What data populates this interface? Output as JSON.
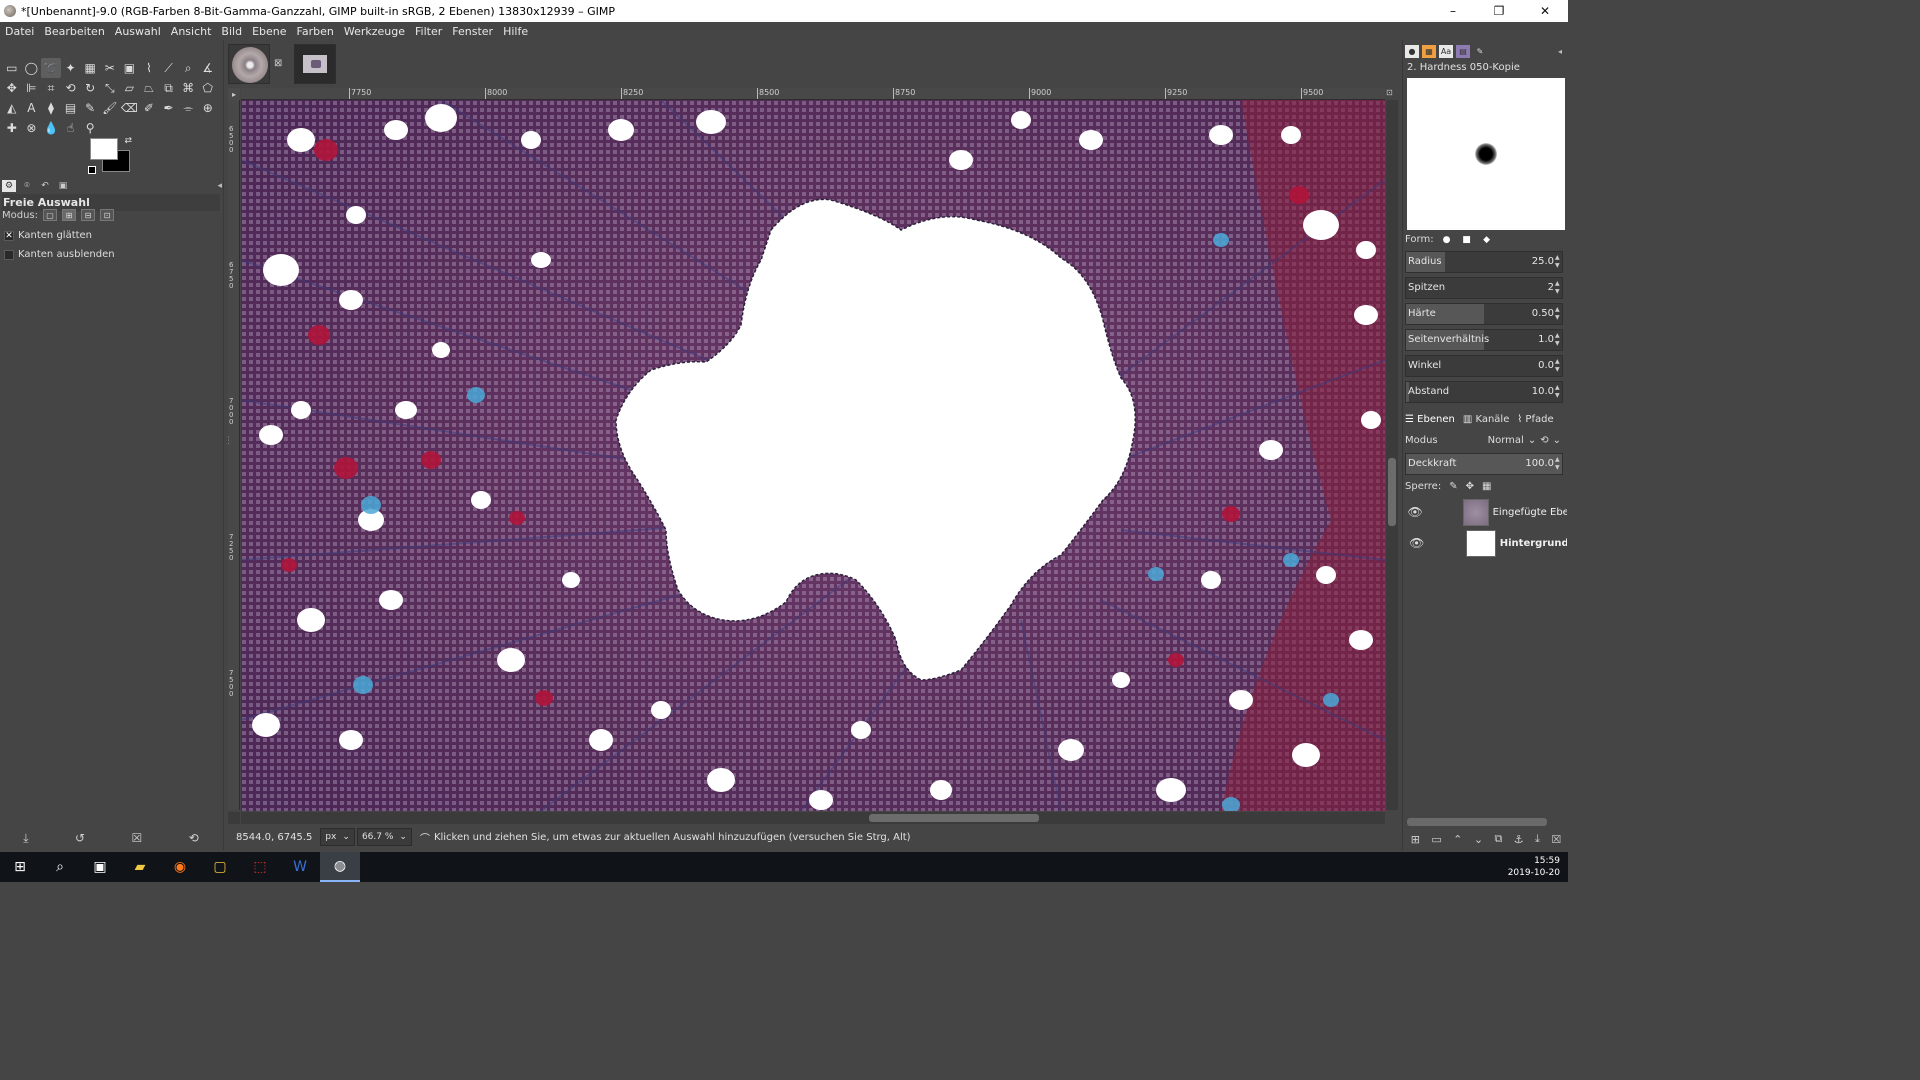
{
  "window": {
    "title": "*[Unbenannt]-9.0 (RGB-Farben 8-Bit-Gamma-Ganzzahl, GIMP built-in sRGB, 2 Ebenen) 13830x12939 – GIMP",
    "minimize": "–",
    "maximize": "❐",
    "close": "✕"
  },
  "menu": [
    "Datei",
    "Bearbeiten",
    "Auswahl",
    "Ansicht",
    "Bild",
    "Ebene",
    "Farben",
    "Werkzeuge",
    "Filter",
    "Fenster",
    "Hilfe"
  ],
  "toolbox": {
    "tool_options_title": "Freie Auswahl",
    "mode_label": "Modus:",
    "option_antialias": "Kanten glätten",
    "option_feather": "Kanten ausblenden"
  },
  "ruler": {
    "h_labels": [
      "7750",
      "8000",
      "8250",
      "8500",
      "8750",
      "9000",
      "9250",
      "9500"
    ],
    "v_labels": [
      "6500",
      "6750",
      "7000",
      "7250",
      "7500"
    ]
  },
  "status": {
    "coords": "8544.0, 6745.5",
    "unit": "px",
    "zoom": "66.7 %",
    "message": "Klicken und ziehen Sie, um etwas zur aktuellen Auswahl hinzuzufügen (versuchen Sie Strg, Alt)"
  },
  "brush": {
    "name": "2. Hardness 050-Kopie",
    "form_label": "Form:",
    "params": [
      {
        "label": "Radius",
        "value": "25.0",
        "fraction": 0.25
      },
      {
        "label": "Spitzen",
        "value": "2",
        "fraction": 0.0
      },
      {
        "label": "Härte",
        "value": "0.50",
        "fraction": 0.5
      },
      {
        "label": "Seitenverhältnis",
        "value": "1.0",
        "fraction": 0.5
      },
      {
        "label": "Winkel",
        "value": "0.0",
        "fraction": 0.0
      },
      {
        "label": "Abstand",
        "value": "10.0",
        "fraction": 0.02
      }
    ]
  },
  "layers_panel": {
    "tabs": [
      "Ebenen",
      "Kanäle",
      "Pfade"
    ],
    "mode_label": "Modus",
    "mode_value": "Normal",
    "opacity_label": "Deckkraft",
    "opacity_value": "100.0",
    "lock_label": "Sperre:",
    "layers": [
      {
        "name": "Eingefügte Ebene",
        "visible": true
      },
      {
        "name": "Hintergrund",
        "visible": true
      }
    ]
  },
  "taskbar": {
    "time": "15:59",
    "date": "2019-10-20"
  }
}
